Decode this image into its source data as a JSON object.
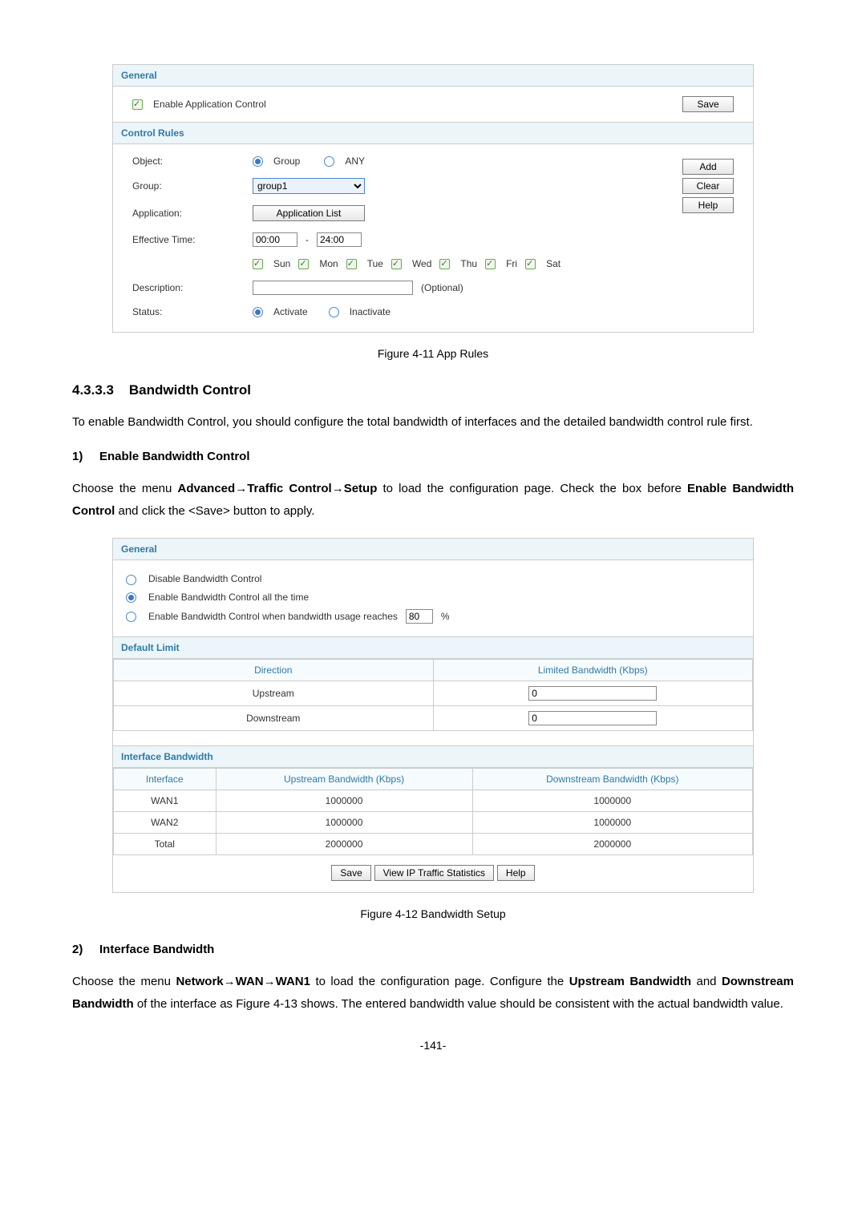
{
  "panel1": {
    "general_label": "General",
    "enable_app_control": "Enable Application Control",
    "save": "Save",
    "control_rules_label": "Control Rules",
    "object_label": "Object:",
    "object_group": "Group",
    "object_any": "ANY",
    "group_label": "Group:",
    "group_value": "group1",
    "application_label": "Application:",
    "application_btn": "Application List",
    "eff_time_label": "Effective Time:",
    "time_from": "00:00",
    "time_to": "24:00",
    "days": {
      "sun": "Sun",
      "mon": "Mon",
      "tue": "Tue",
      "wed": "Wed",
      "thu": "Thu",
      "fri": "Fri",
      "sat": "Sat"
    },
    "description_label": "Description:",
    "description_hint": "(Optional)",
    "status_label": "Status:",
    "status_activate": "Activate",
    "status_inactivate": "Inactivate",
    "add": "Add",
    "clear": "Clear",
    "help": "Help"
  },
  "fig1": "Figure 4-11 App Rules",
  "section_num": "4.3.3.3",
  "section_title": "Bandwidth Control",
  "para1": "To enable Bandwidth Control, you should configure the total bandwidth of interfaces and the detailed bandwidth control rule first.",
  "step1_num": "1)",
  "step1_title": "Enable Bandwidth Control",
  "para2_a": "Choose the menu ",
  "para2_b1": "Advanced",
  "para2_b2": "Traffic Control",
  "para2_b3": "Setup",
  "para2_c": " to load the configuration page. Check the box before ",
  "para2_d": "Enable Bandwidth Control",
  "para2_e": " and click the <Save> button to apply.",
  "panel2": {
    "general_label": "General",
    "opt_disable": "Disable Bandwidth Control",
    "opt_all": "Enable Bandwidth Control all the time",
    "opt_reach": "Enable Bandwidth Control when bandwidth usage reaches",
    "pct_value": "80",
    "pct_unit": "%",
    "default_limit_label": "Default Limit",
    "col_direction": "Direction",
    "col_limited": "Limited Bandwidth (Kbps)",
    "row_upstream": "Upstream",
    "row_downstream": "Downstream",
    "upstream_val": "0",
    "downstream_val": "0",
    "iface_bw_label": "Interface Bandwidth",
    "col_iface": "Interface",
    "col_up": "Upstream Bandwidth (Kbps)",
    "col_down": "Downstream Bandwidth (Kbps)",
    "rows": [
      {
        "iface": "WAN1",
        "up": "1000000",
        "down": "1000000"
      },
      {
        "iface": "WAN2",
        "up": "1000000",
        "down": "1000000"
      },
      {
        "iface": "Total",
        "up": "2000000",
        "down": "2000000"
      }
    ],
    "save": "Save",
    "view_stats": "View IP Traffic Statistics",
    "help": "Help"
  },
  "fig2": "Figure 4-12 Bandwidth Setup",
  "step2_num": "2)",
  "step2_title": "Interface Bandwidth",
  "para3_a": "Choose the menu ",
  "para3_b1": "Network",
  "para3_b2": "WAN",
  "para3_b3": "WAN1",
  "para3_c": " to load the configuration page. Configure the ",
  "para3_d": "Upstream Bandwidth",
  "para3_e": " and ",
  "para3_f": "Downstream Bandwidth",
  "para3_g": " of the interface as Figure 4-13 shows. The entered bandwidth value should be consistent with the actual bandwidth value.",
  "page_num": "-141-"
}
